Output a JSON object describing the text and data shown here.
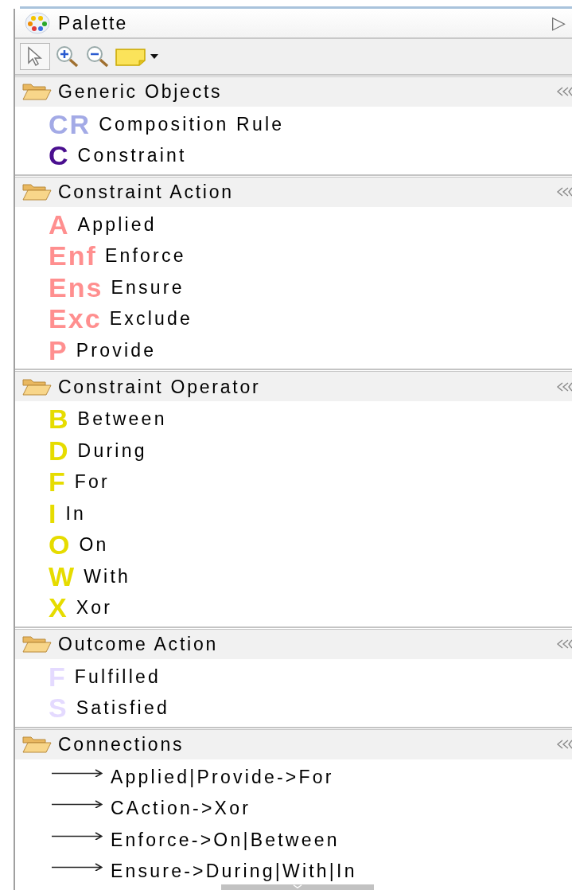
{
  "palette": {
    "title": "Palette",
    "collapse_glyph": "▷"
  },
  "sections": [
    {
      "title": "Generic Objects",
      "items": [
        {
          "kind": "letter",
          "badge": "CR",
          "color": "#a3aae6",
          "label": "Composition Rule"
        },
        {
          "kind": "letter",
          "badge": "C",
          "color": "#4a0f8f",
          "label": "Constraint"
        }
      ]
    },
    {
      "title": "Constraint Action",
      "items": [
        {
          "kind": "letter",
          "badge": "A",
          "color": "#ff8f8f",
          "label": "Applied"
        },
        {
          "kind": "letter",
          "badge": "Enf",
          "color": "#ff8f8f",
          "label": "Enforce"
        },
        {
          "kind": "letter",
          "badge": "Ens",
          "color": "#ff8f8f",
          "label": "Ensure"
        },
        {
          "kind": "letter",
          "badge": "Exc",
          "color": "#ff8f8f",
          "label": "Exclude"
        },
        {
          "kind": "letter",
          "badge": "P",
          "color": "#ff8f8f",
          "label": "Provide"
        }
      ]
    },
    {
      "title": "Constraint Operator",
      "items": [
        {
          "kind": "letter",
          "badge": "B",
          "color": "#e6dc00",
          "label": "Between"
        },
        {
          "kind": "letter",
          "badge": "D",
          "color": "#e6dc00",
          "label": "During"
        },
        {
          "kind": "letter",
          "badge": "F",
          "color": "#e6dc00",
          "label": "For"
        },
        {
          "kind": "letter",
          "badge": "I",
          "color": "#e6dc00",
          "label": "In"
        },
        {
          "kind": "letter",
          "badge": "O",
          "color": "#e6dc00",
          "label": "On"
        },
        {
          "kind": "letter",
          "badge": "W",
          "color": "#e6dc00",
          "label": "With"
        },
        {
          "kind": "letter",
          "badge": "X",
          "color": "#e6dc00",
          "label": "Xor"
        }
      ]
    },
    {
      "title": "Outcome Action",
      "items": [
        {
          "kind": "letter",
          "badge": "F",
          "color": "#e4daff",
          "label": "Fulfilled"
        },
        {
          "kind": "letter",
          "badge": "S",
          "color": "#e4daff",
          "label": "Satisfied"
        }
      ]
    },
    {
      "title": "Connections",
      "items": [
        {
          "kind": "connection",
          "label": "Applied|Provide->For"
        },
        {
          "kind": "connection",
          "label": "CAction->Xor"
        },
        {
          "kind": "connection",
          "label": "Enforce->On|Between"
        },
        {
          "kind": "connection",
          "label": "Ensure->During|With|In"
        }
      ]
    }
  ]
}
